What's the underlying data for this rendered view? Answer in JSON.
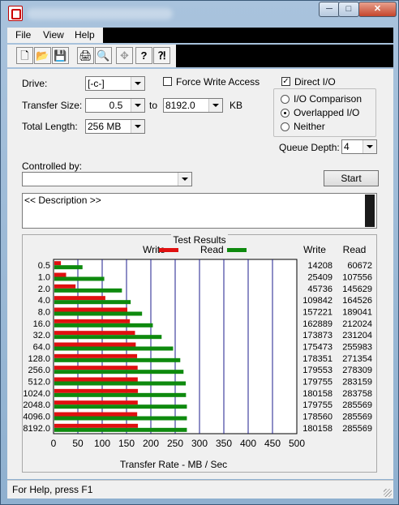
{
  "window": {
    "minimize_glyph": "─",
    "maximize_glyph": "□",
    "close_glyph": "✕"
  },
  "menu": {
    "file": "File",
    "view": "View",
    "help": "Help"
  },
  "toolbar": {
    "icons": [
      "new-file-icon",
      "open-folder-icon",
      "save-icon",
      "print-icon",
      "print-preview-icon",
      "move-icon",
      "help-icon",
      "context-help-icon"
    ],
    "glyphs": [
      "🗋",
      "📂",
      "💾",
      "🖨",
      "🔍",
      "✥",
      "?",
      "⁈"
    ]
  },
  "drive": {
    "label": "Drive:",
    "value": "[-c-]"
  },
  "force_write": {
    "label": "Force Write Access",
    "checked": false
  },
  "direct_io": {
    "label": "Direct I/O",
    "checked": true,
    "mark": "✓"
  },
  "transfer_size": {
    "label": "Transfer Size:",
    "from": "0.5",
    "to_label": "to",
    "to": "8192.0",
    "unit": "KB"
  },
  "total_length": {
    "label": "Total Length:",
    "value": "256 MB"
  },
  "io_mode": {
    "options": [
      "I/O Comparison",
      "Overlapped I/O",
      "Neither"
    ],
    "selected": "Overlapped I/O"
  },
  "queue_depth": {
    "label": "Queue Depth:",
    "value": "4"
  },
  "controlled_by": {
    "label": "Controlled by:",
    "value": ""
  },
  "start_button": "Start",
  "description": "<< Description >>",
  "results": {
    "title": "Test Results",
    "legend_write": "Write",
    "legend_read": "Read",
    "col_write": "Write",
    "col_read": "Read"
  },
  "status_text": "For Help, press F1",
  "chart_data": {
    "type": "bar",
    "orientation": "horizontal",
    "title": "Test Results",
    "xlabel": "Transfer Rate - MB / Sec",
    "xlim": [
      0,
      500
    ],
    "xticks": [
      "0",
      "50",
      "100",
      "150",
      "200",
      "250",
      "300",
      "350",
      "400",
      "450",
      "500"
    ],
    "categories": [
      "0.5",
      "1.0",
      "2.0",
      "4.0",
      "8.0",
      "16.0",
      "32.0",
      "64.0",
      "128.0",
      "256.0",
      "512.0",
      "1024.0",
      "2048.0",
      "4096.0",
      "8192.0"
    ],
    "series": [
      {
        "name": "Write",
        "color": "#e01010",
        "values": [
          13.5,
          24.2,
          43.6,
          104.8,
          150.0,
          155.3,
          165.8,
          167.3,
          170.1,
          171.2,
          171.4,
          171.8,
          171.4,
          170.3,
          171.8
        ]
      },
      {
        "name": "Read",
        "color": "#0e8a0e",
        "values": [
          57.9,
          102.6,
          138.9,
          156.9,
          180.3,
          202.4,
          220.5,
          244.1,
          258.8,
          265.5,
          270.1,
          270.6,
          272.4,
          272.4,
          272.4
        ]
      }
    ],
    "table": {
      "write": [
        "14208",
        "25409",
        "45736",
        "109842",
        "157221",
        "162889",
        "173873",
        "175473",
        "178351",
        "179553",
        "179755",
        "180158",
        "179755",
        "178560",
        "180158"
      ],
      "read": [
        "60672",
        "107556",
        "145629",
        "164526",
        "189041",
        "212024",
        "231204",
        "255983",
        "271354",
        "278309",
        "283159",
        "283758",
        "285569",
        "285569",
        "285569"
      ]
    },
    "grid": true,
    "legend": "top-center"
  }
}
